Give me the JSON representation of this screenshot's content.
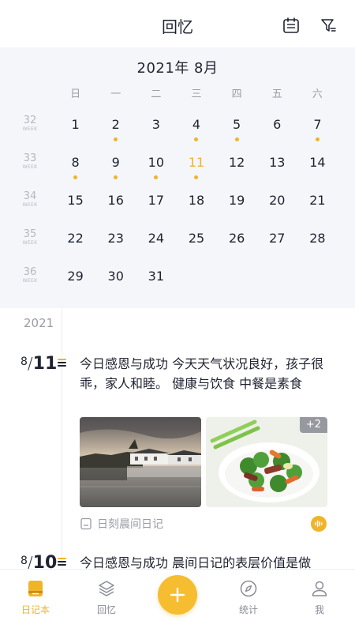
{
  "header": {
    "title": "回忆",
    "calendar_icon": "calendar-icon",
    "filter_icon": "filter-icon"
  },
  "calendar": {
    "month_title": "2021年  8月",
    "weekdays": [
      "日",
      "一",
      "二",
      "三",
      "四",
      "五",
      "六"
    ],
    "week_label": "WEEK",
    "weeks": [
      {
        "week": "32",
        "days": [
          "1",
          "2",
          "3",
          "4",
          "5",
          "6",
          "7"
        ]
      },
      {
        "week": "33",
        "days": [
          "8",
          "9",
          "10",
          "11",
          "12",
          "13",
          "14"
        ]
      },
      {
        "week": "34",
        "days": [
          "15",
          "16",
          "17",
          "18",
          "19",
          "20",
          "21"
        ]
      },
      {
        "week": "35",
        "days": [
          "22",
          "23",
          "24",
          "25",
          "26",
          "27",
          "28"
        ]
      },
      {
        "week": "36",
        "days": [
          "29",
          "30",
          "31",
          "",
          "",
          "",
          ""
        ]
      }
    ],
    "days_with_entries": [
      "2",
      "4",
      "5",
      "7",
      "8",
      "9",
      "10",
      "11"
    ],
    "today": "11",
    "accent_color": "#f0b429"
  },
  "journal": {
    "year": "2021",
    "entries": [
      {
        "month": "8",
        "day": "11",
        "text": "今日感恩与成功 今天天气状况良好，孩子很乖，家人和睦。 健康与饮食 中餐是素食",
        "more_photos": "+2",
        "diary_type": "日刻晨间日记",
        "diary_icon": "journal-book-icon",
        "audio_icon": "audio-wave-icon"
      },
      {
        "month": "8",
        "day": "10",
        "text": "今日感恩与成功 晨间日记的表层价值是做"
      }
    ]
  },
  "tabbar": {
    "items": [
      {
        "label": "日记本",
        "icon": "diary-icon",
        "active": true
      },
      {
        "label": "回忆",
        "icon": "layers-icon",
        "active": false
      },
      {
        "label": "",
        "icon": "plus-icon",
        "active": false
      },
      {
        "label": "统计",
        "icon": "compass-icon",
        "active": false
      },
      {
        "label": "我",
        "icon": "user-icon",
        "active": false
      }
    ]
  }
}
